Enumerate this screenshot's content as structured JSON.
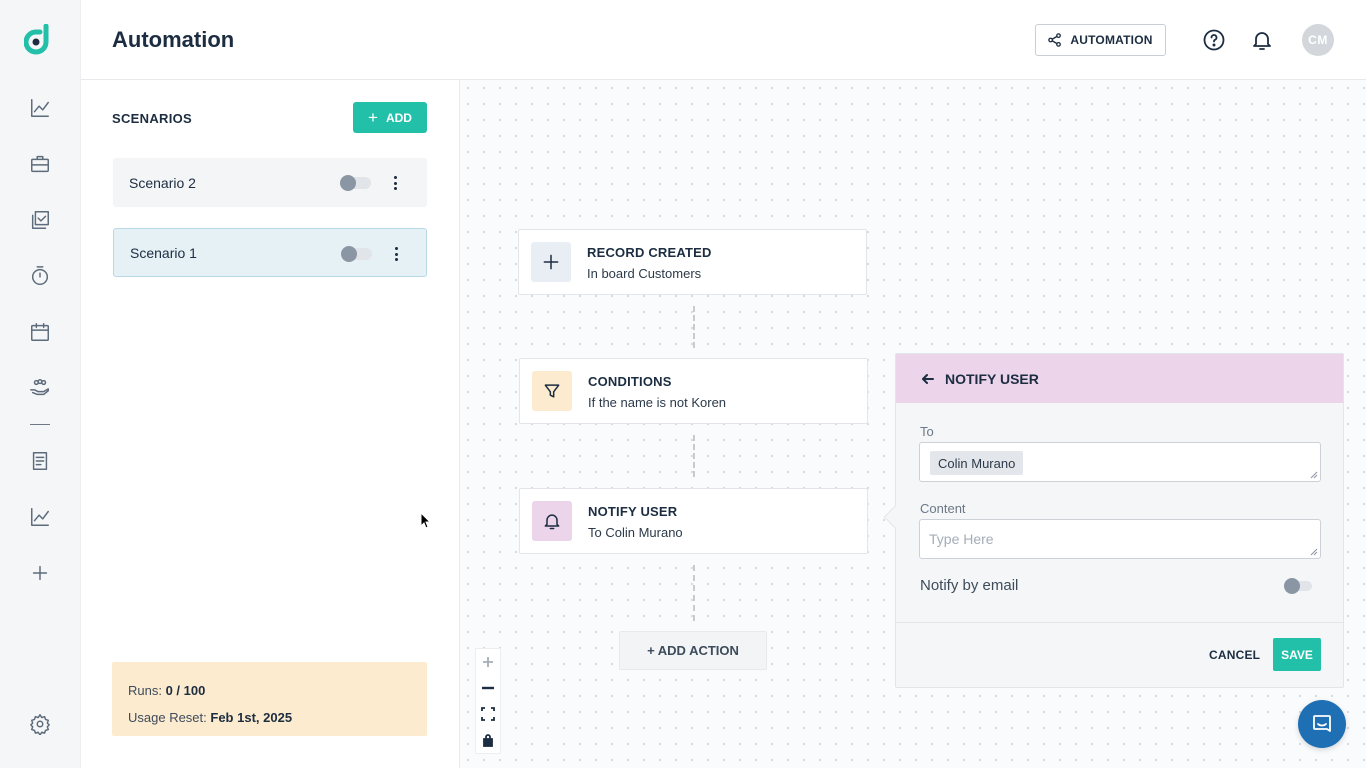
{
  "header": {
    "title": "Automation",
    "automation_button": "AUTOMATION",
    "avatar_initials": "CM"
  },
  "scenarios": {
    "title": "SCENARIOS",
    "add_label": "ADD",
    "items": [
      {
        "name": "Scenario 2",
        "enabled": false,
        "selected": false
      },
      {
        "name": "Scenario 1",
        "enabled": false,
        "selected": true
      }
    ],
    "usage": {
      "runs_label": "Runs:",
      "runs_value": "0 / 100",
      "reset_label": "Usage Reset:",
      "reset_value": "Feb 1st, 2025"
    }
  },
  "flow": {
    "nodes": [
      {
        "title": "RECORD CREATED",
        "subtitle": "In board Customers",
        "icon": "plus-icon",
        "icon_bg": "#e8eef3"
      },
      {
        "title": "CONDITIONS",
        "subtitle": "If the name is not Koren",
        "icon": "filter-icon",
        "icon_bg": "#fdebcf"
      },
      {
        "title": "NOTIFY USER",
        "subtitle": "To Colin Murano",
        "icon": "bell-icon",
        "icon_bg": "#ecd4ea"
      }
    ],
    "add_action_label": "+ ADD ACTION"
  },
  "notify_panel": {
    "title": "NOTIFY USER",
    "to_label": "To",
    "to_recipient": "Colin Murano",
    "content_label": "Content",
    "content_placeholder": "Type Here",
    "email_label": "Notify by email",
    "email_enabled": false,
    "cancel_label": "CANCEL",
    "save_label": "SAVE"
  },
  "colors": {
    "accent": "#22c0a8",
    "notify_header": "#ecd4ea",
    "usage_bg": "#fdebcf",
    "chat_button": "#1f6fb5"
  }
}
